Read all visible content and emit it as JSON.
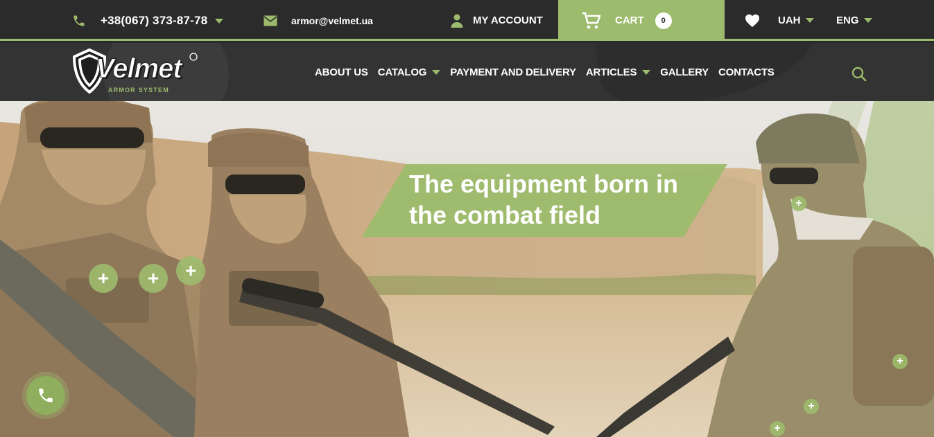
{
  "topbar": {
    "phone": "+38(067) 373-87-78",
    "email": "armor@velmet.ua",
    "account_label": "MY ACCOUNT",
    "cart_label": "CART",
    "cart_count": "0",
    "currency": "UAH",
    "language": "ENG"
  },
  "logo": {
    "brand": "Velmet",
    "tagline": "ARMOR SYSTEM"
  },
  "nav": {
    "items": [
      {
        "label": "ABOUT US"
      },
      {
        "label": "CATALOG"
      },
      {
        "label": "PAYMENT AND DELIVERY"
      },
      {
        "label": "ARTICLES"
      },
      {
        "label": "GALLERY"
      },
      {
        "label": "CONTACTS"
      }
    ]
  },
  "hero": {
    "slogan_line1": "The equipment born in",
    "slogan_line2": "the combat field",
    "hotspot_symbol": "+"
  },
  "icons": {
    "phone": "phone-icon",
    "mail": "mail-icon",
    "account": "user-icon",
    "cart": "cart-icon",
    "wishlist": "heart-icon",
    "search": "search-icon",
    "callback": "phone-icon"
  },
  "colors": {
    "accent": "#9dbb6d",
    "topbar_bg": "#2b2b2b",
    "navbar_bg": "#333333",
    "text": "#ffffff"
  }
}
